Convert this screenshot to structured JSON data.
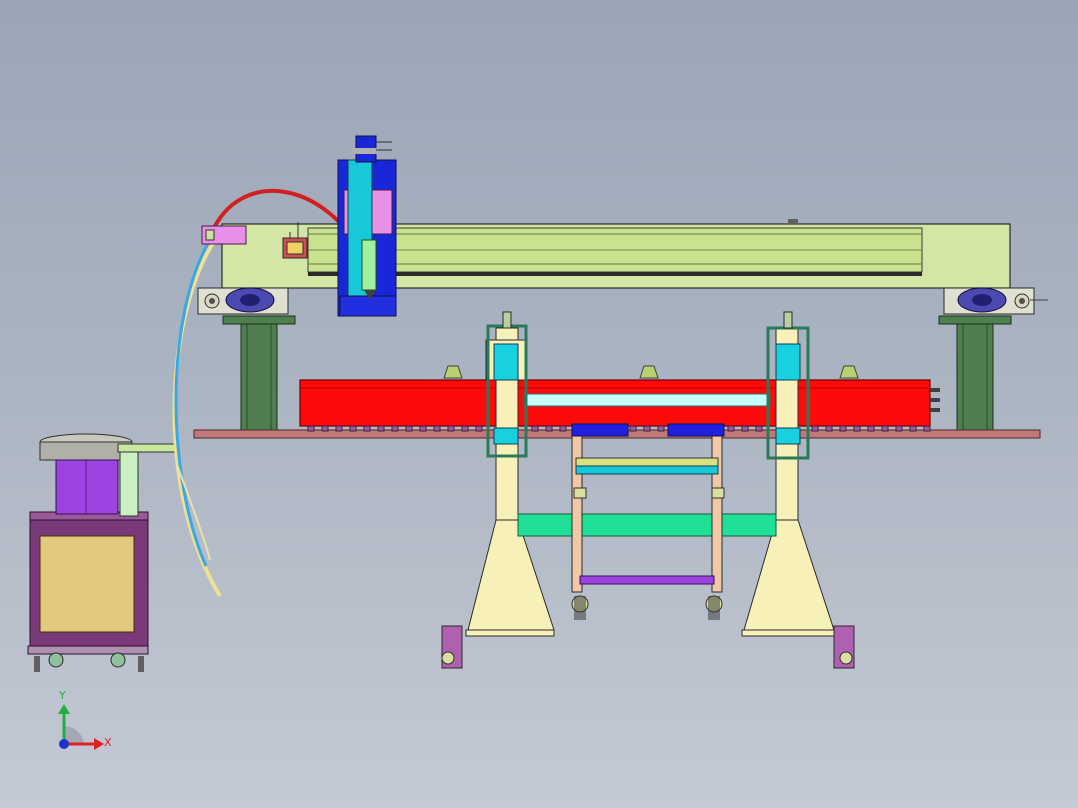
{
  "viewport": {
    "background_top": "#9aa5b6",
    "background_bottom": "#c4cad4"
  },
  "triad": {
    "x_label": "X",
    "y_label": "Y",
    "x_color": "#e02020",
    "y_color": "#20b040",
    "origin_color": "#2030d0"
  },
  "colors": {
    "gantry_beam": "#d4e6a6",
    "cylinder": "#ff0a0a",
    "base_plate": "#c07878",
    "column": "#4f7f4e",
    "stand": "#f7f0b8",
    "cart_frame": "#f0c8a8",
    "brace": "#20e098",
    "feeder_cabinet": "#e2c97e",
    "feeder_bowl": "#9d44e0",
    "carriage": "#e890e8",
    "bracket_blue": "#1020d0",
    "teal_block": "#18d0e0",
    "air_hose_red": "#d02020",
    "air_hose_blue": "#38a8e8",
    "air_hose_yellow": "#f0e090"
  },
  "icons": [
    "coordinate-triad-icon"
  ]
}
